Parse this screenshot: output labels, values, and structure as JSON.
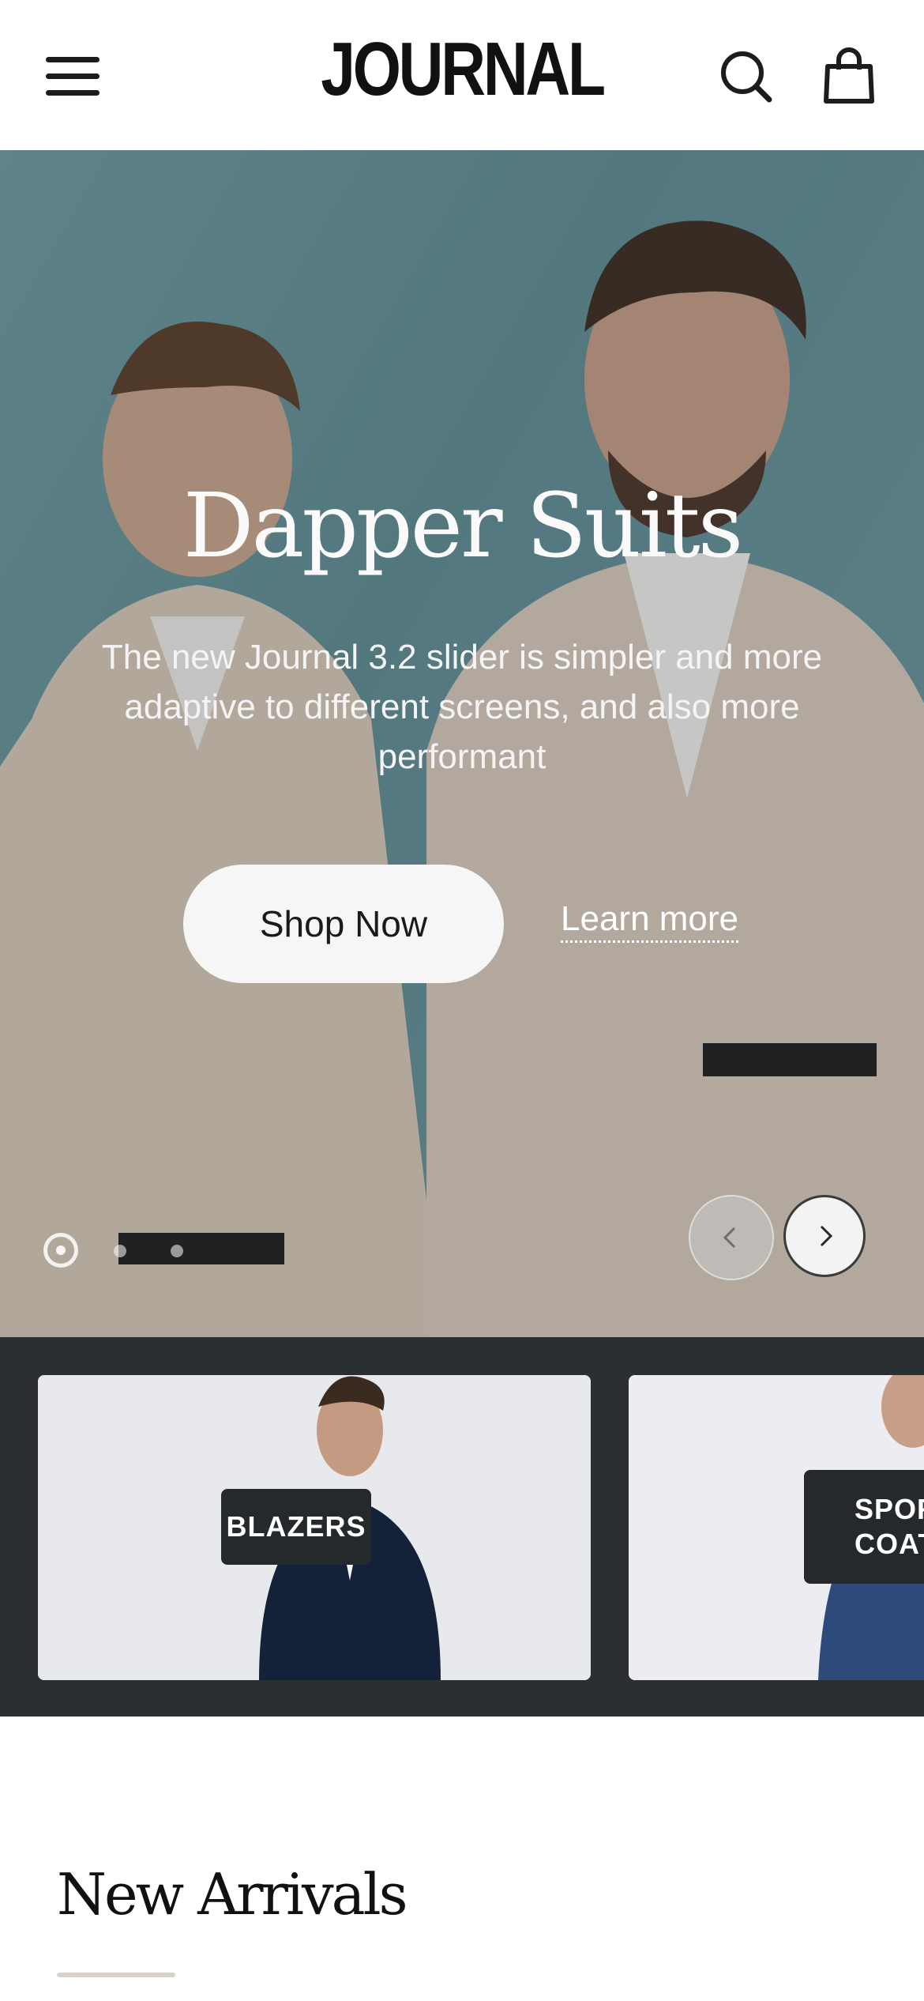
{
  "header": {
    "logo": "JOURNAL",
    "menu_icon": "hamburger-menu-icon",
    "search_icon": "search-icon",
    "cart_icon": "shopping-bag-icon"
  },
  "hero": {
    "title": "Dapper Suits",
    "subtitle": "The new Journal 3.2 slider is simpler and more adaptive to different screens, and also more performant",
    "primary_button": "Shop Now",
    "secondary_link": "Learn more",
    "slides_count": 3,
    "active_slide": 1,
    "prev_icon": "chevron-left-icon",
    "next_icon": "chevron-right-icon"
  },
  "categories": [
    {
      "label": "BLAZERS"
    },
    {
      "label": "SPOR\nCOAT"
    }
  ],
  "sections": {
    "new_arrivals_title": "New Arrivals"
  },
  "colors": {
    "hero_bg": "#5e8c93",
    "strip_bg": "#2a2f32",
    "label_bg": "#25292b",
    "accent_rule": "#d7d2cc"
  }
}
